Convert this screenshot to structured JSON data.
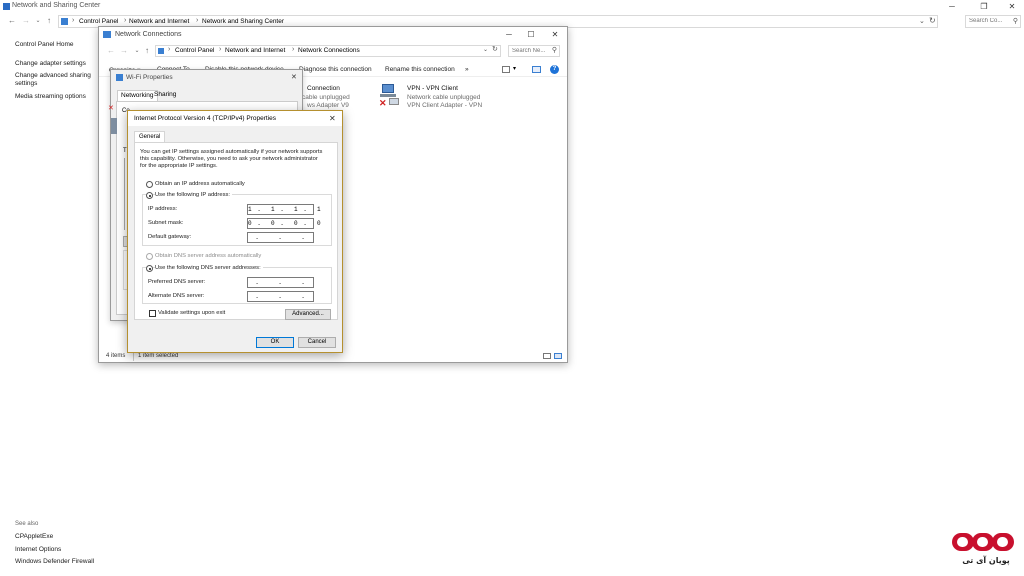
{
  "main_window": {
    "title": "Network and Sharing Center",
    "breadcrumb": [
      "Control Panel",
      "Network and Internet",
      "Network and Sharing Center"
    ],
    "search_placeholder": "Search Co...",
    "sidebar": {
      "home": "Control Panel Home",
      "links": [
        "Change adapter settings",
        "Change advanced sharing settings",
        "Media streaming options"
      ],
      "see_also_label": "See also",
      "see_also": [
        "CPAppletExe",
        "Internet Options",
        "Windows Defender Firewall"
      ]
    }
  },
  "network_connections": {
    "title": "Network Connections",
    "breadcrumb": [
      "Control Panel",
      "Network and Internet",
      "Network Connections"
    ],
    "search_placeholder": "Search Ne...",
    "toolbar": [
      "Organize ▾",
      "Connect To",
      "Disable this network device",
      "Diagnose this connection",
      "Rename this connection",
      "»"
    ],
    "connections": [
      {
        "name": "Connection",
        "status": "cable unplugged",
        "adapter": "ws Adapter V9"
      },
      {
        "name": "VPN - VPN Client",
        "status": "Network cable unplugged",
        "adapter": "VPN Client Adapter - VPN"
      }
    ],
    "status_bar": {
      "items": "4 items",
      "selected": "1 item selected"
    }
  },
  "wifi_properties": {
    "title": "Wi-Fi Properties",
    "tabs": [
      "Networking",
      "Sharing"
    ],
    "partial_labels": [
      "Co",
      "Th"
    ]
  },
  "ipv4_dialog": {
    "title": "Internet Protocol Version 4 (TCP/IPv4) Properties",
    "tab": "General",
    "description": [
      "You can get IP settings assigned automatically if your network supports",
      "this capability. Otherwise, you need to ask your network administrator",
      "for the appropriate IP settings."
    ],
    "ip_auto_label": "Obtain an IP address automatically",
    "ip_manual_label": "Use the following IP address:",
    "ip_address_label": "IP address:",
    "ip_address": "1 .  1 .  1 .  1",
    "subnet_label": "Subnet mask:",
    "subnet": "0 .  0 .  0 .  0",
    "gateway_label": "Default gateway:",
    "gateway": " .    .    . ",
    "dns_auto_label": "Obtain DNS server address automatically",
    "dns_manual_label": "Use the following DNS server addresses:",
    "preferred_dns_label": "Preferred DNS server:",
    "preferred_dns": " .    .    . ",
    "alternate_dns_label": "Alternate DNS server:",
    "alternate_dns": " .    .    . ",
    "validate_label": "Validate settings upon exit",
    "advanced_label": "Advanced...",
    "ok_label": "OK",
    "cancel_label": "Cancel"
  },
  "watermark": {
    "text": "پویان آی تی",
    "color": "#c8102e"
  }
}
